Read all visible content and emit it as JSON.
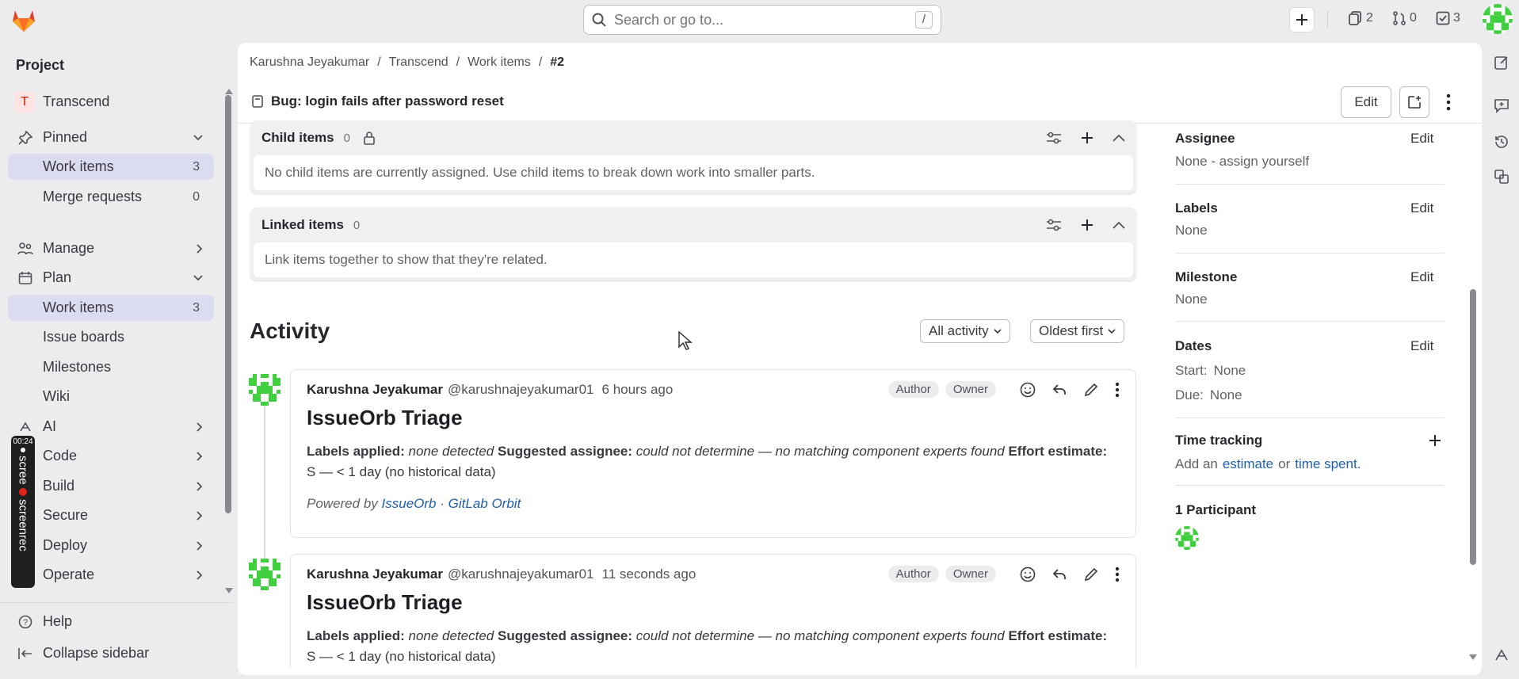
{
  "topbar": {
    "search_placeholder": "Search or go to...",
    "search_shortcut": "/",
    "issues_count": "2",
    "mrs_count": "0",
    "todos_count": "3"
  },
  "sidebar": {
    "heading": "Project",
    "project_name": "Transcend",
    "project_initial": "T",
    "pinned": {
      "label": "Pinned",
      "items": [
        {
          "label": "Work items",
          "count": "3"
        },
        {
          "label": "Merge requests",
          "count": "0"
        }
      ]
    },
    "sections": [
      {
        "label": "Manage",
        "icon": "users-icon"
      },
      {
        "label": "Plan",
        "icon": "calendar-icon"
      }
    ],
    "plan_items": [
      {
        "label": "Work items",
        "count": "3"
      },
      {
        "label": "Issue boards"
      },
      {
        "label": "Milestones"
      },
      {
        "label": "Wiki"
      }
    ],
    "more_sections": [
      {
        "label": "AI"
      },
      {
        "label": "Code"
      },
      {
        "label": "Build"
      },
      {
        "label": "Secure"
      },
      {
        "label": "Deploy"
      },
      {
        "label": "Operate"
      }
    ],
    "help": "Help",
    "collapse": "Collapse sidebar"
  },
  "recorder": {
    "time": "00:24",
    "label1": "scree",
    "label2": "screenrec"
  },
  "breadcrumb": [
    "Karushna Jeyakumar",
    "Transcend",
    "Work items",
    "#2"
  ],
  "work_item": {
    "title": "Bug: login fails after password reset",
    "edit_label": "Edit"
  },
  "child_items": {
    "label": "Child items",
    "count": "0",
    "empty_text": "No child items are currently assigned. Use child items to break down work into smaller parts."
  },
  "linked_items": {
    "label": "Linked items",
    "count": "0",
    "empty_text": "Link items together to show that they're related."
  },
  "activity": {
    "title": "Activity",
    "filter": "All activity",
    "sort": "Oldest first",
    "notes": [
      {
        "author": "Karushna Jeyakumar",
        "handle": "@karushnajeyakumar01",
        "time": "6 hours ago",
        "badges": [
          "Author",
          "Owner"
        ],
        "heading": "IssueOrb Triage",
        "labels_key": "Labels applied:",
        "labels_val": "none detected",
        "assignee_key": "Suggested assignee:",
        "assignee_val": "could not determine — no matching component experts found",
        "effort_key": "Effort estimate:",
        "effort_val": "S — < 1 day (no historical data)",
        "powered_by": "Powered by",
        "link1": "IssueOrb",
        "sep": "·",
        "link2": "GitLab Orbit"
      },
      {
        "author": "Karushna Jeyakumar",
        "handle": "@karushnajeyakumar01",
        "time": "11 seconds ago",
        "badges": [
          "Author",
          "Owner"
        ],
        "heading": "IssueOrb Triage",
        "labels_key": "Labels applied:",
        "labels_val": "none detected",
        "assignee_key": "Suggested assignee:",
        "assignee_val": "could not determine — no matching component experts found",
        "effort_key": "Effort estimate:",
        "effort_val": "S — < 1 day (no historical data)"
      }
    ]
  },
  "right_sidebar": {
    "assignee": {
      "label": "Assignee",
      "edit": "Edit",
      "value": "None - assign yourself"
    },
    "labels": {
      "label": "Labels",
      "edit": "Edit",
      "value": "None"
    },
    "milestone": {
      "label": "Milestone",
      "edit": "Edit",
      "value": "None"
    },
    "dates": {
      "label": "Dates",
      "edit": "Edit",
      "start_key": "Start:",
      "start_val": "None",
      "due_key": "Due:",
      "due_val": "None"
    },
    "time_tracking": {
      "label": "Time tracking",
      "add": "Add an",
      "estimate": "estimate",
      "or": "or",
      "spent": "time spent."
    },
    "participants": {
      "label": "1 Participant"
    }
  },
  "colors": {
    "accent": "#1f5fa8",
    "active_nav": "#dcdcf0",
    "brand_orange": "#e24329"
  }
}
